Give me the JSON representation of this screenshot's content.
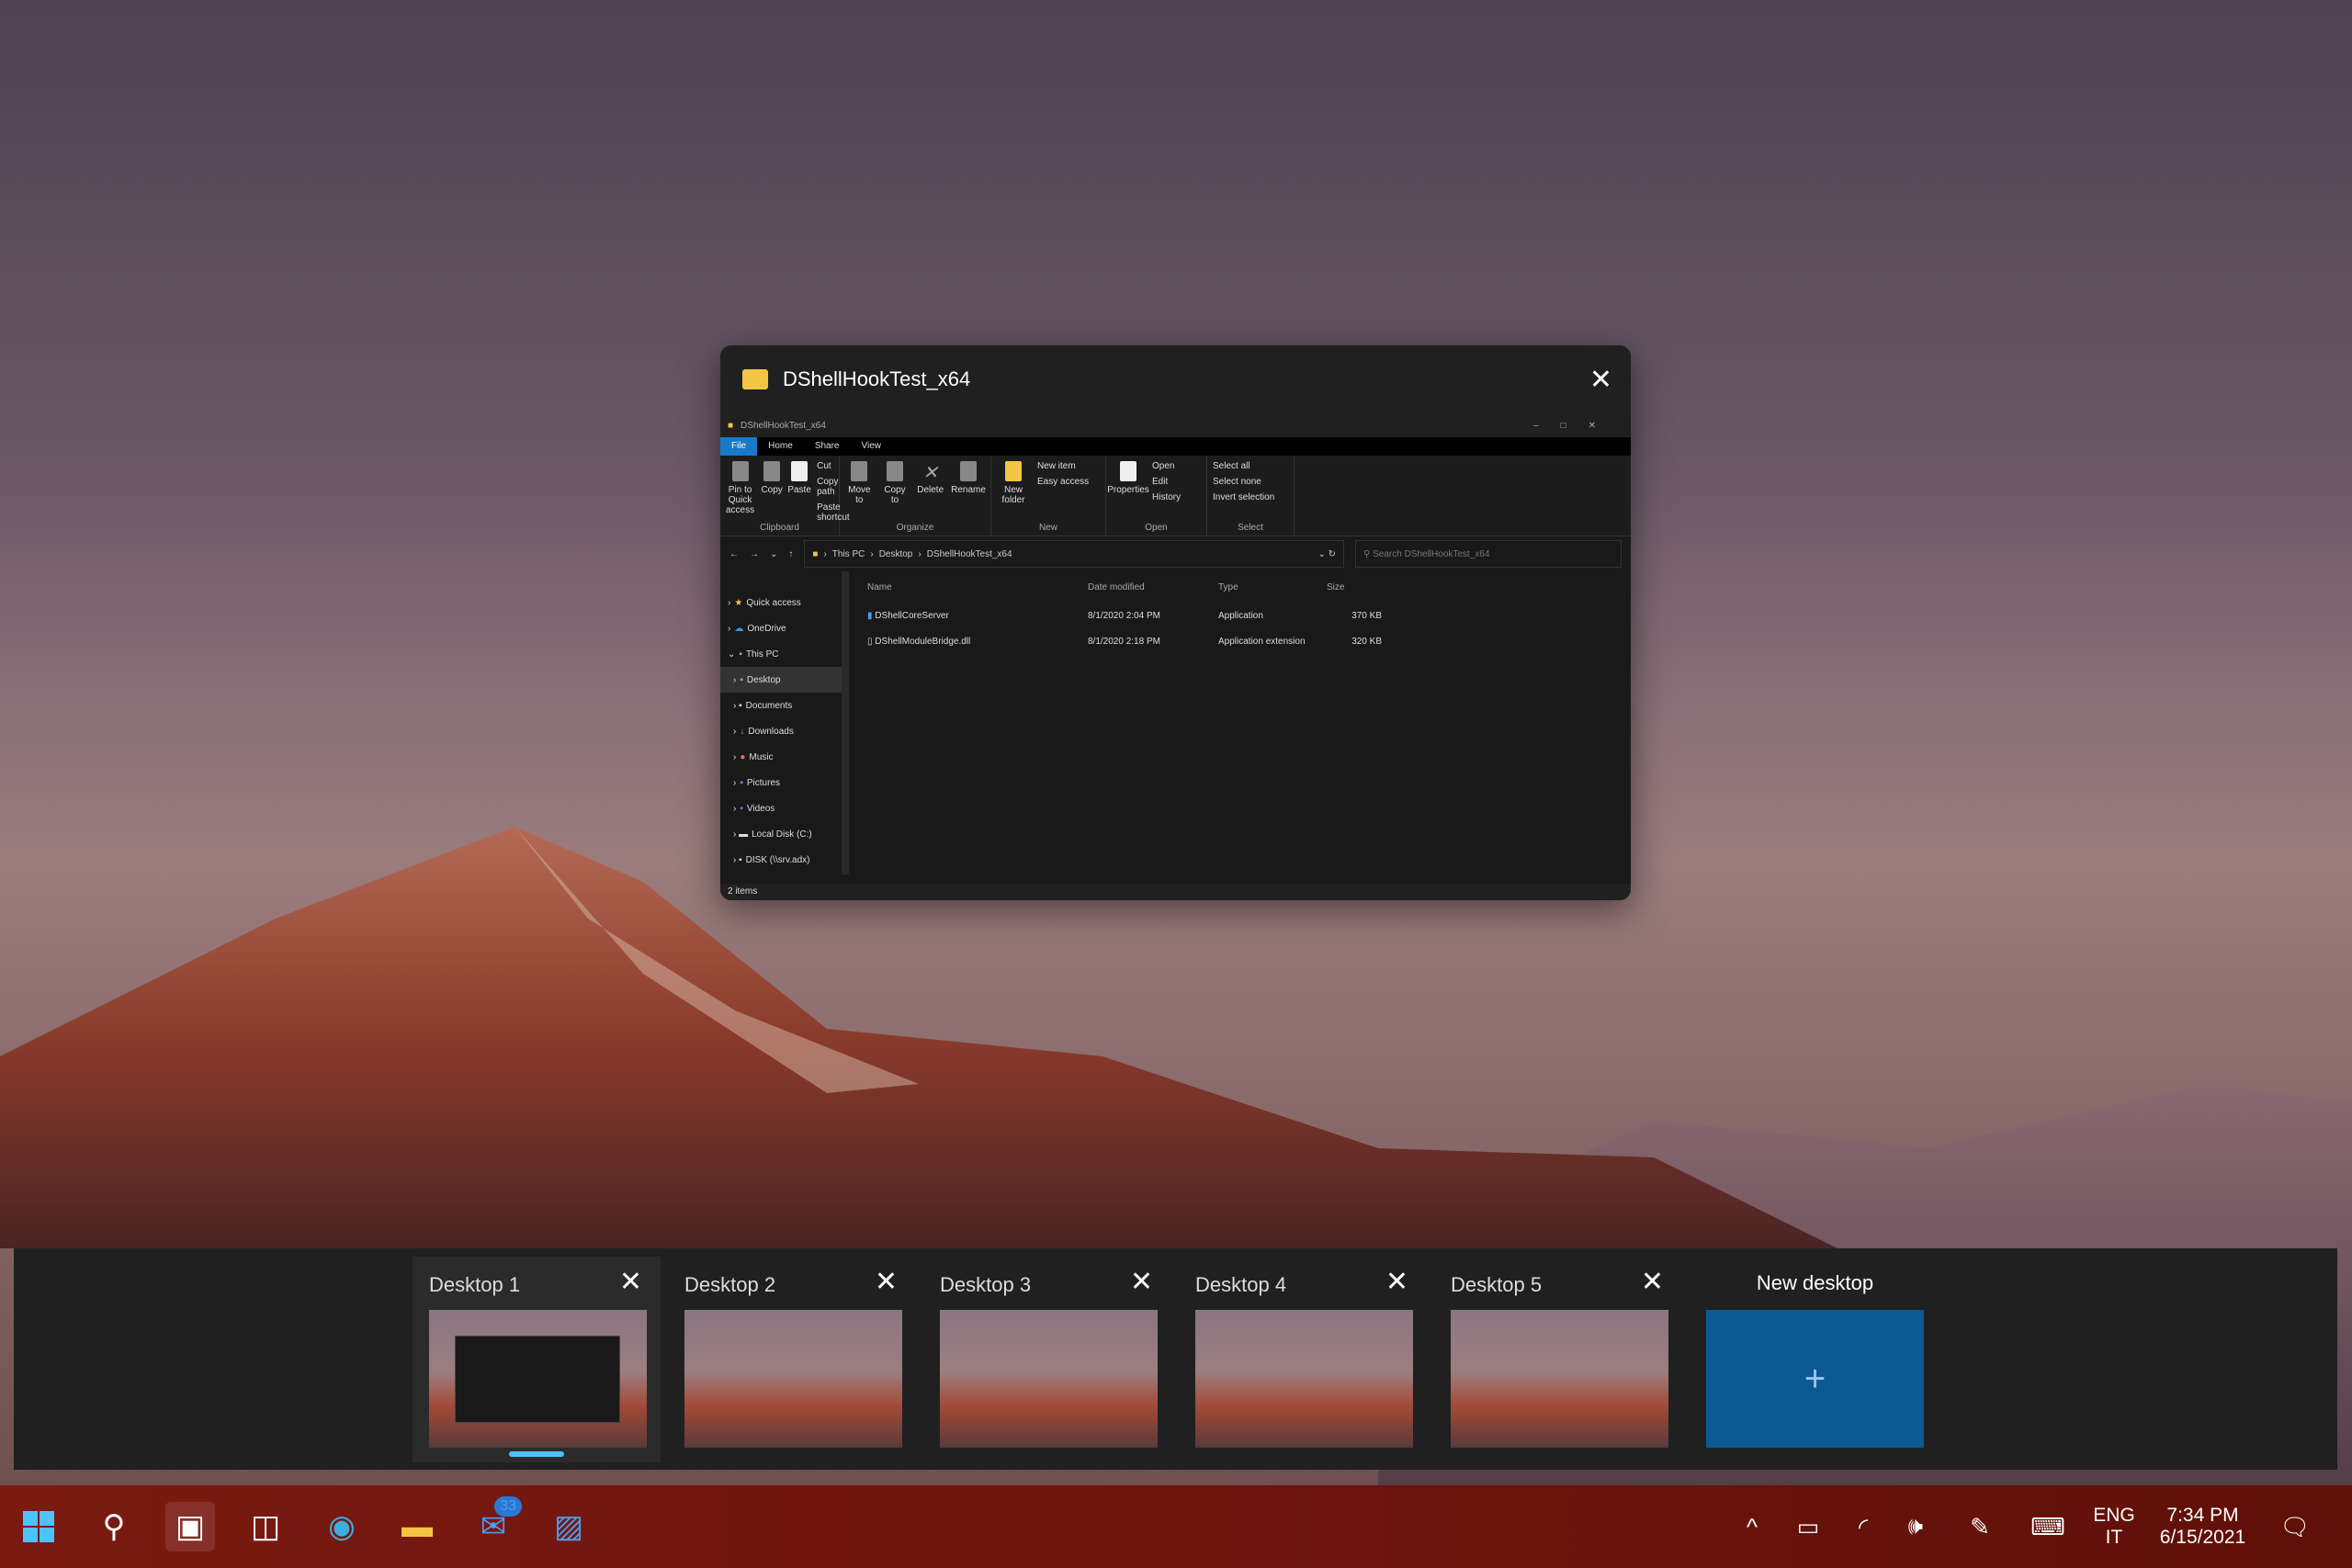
{
  "window_card": {
    "title": "DShellHookTest_x64",
    "close": "✕"
  },
  "explorer": {
    "title": "DShellHookTest_x64",
    "tabs": [
      "File",
      "Home",
      "Share",
      "View"
    ],
    "ribbon": {
      "clipboard": {
        "label": "Clipboard",
        "pin": "Pin to Quick access",
        "copy": "Copy",
        "paste": "Paste",
        "cut": "Cut",
        "copy_path": "Copy path",
        "paste_shortcut": "Paste shortcut"
      },
      "organize": {
        "label": "Organize",
        "move": "Move to",
        "copy": "Copy to",
        "delete": "Delete",
        "rename": "Rename"
      },
      "new": {
        "label": "New",
        "folder": "New folder",
        "item": "New item",
        "easy": "Easy access"
      },
      "open": {
        "label": "Open",
        "properties": "Properties",
        "open": "Open",
        "edit": "Edit",
        "history": "History"
      },
      "select": {
        "label": "Select",
        "all": "Select all",
        "none": "Select none",
        "invert": "Invert selection"
      }
    },
    "breadcrumb": [
      "This PC",
      "Desktop",
      "DShellHookTest_x64"
    ],
    "search_placeholder": "Search DShellHookTest_x64",
    "nav": [
      "Quick access",
      "OneDrive",
      "This PC",
      "Desktop",
      "Documents",
      "Downloads",
      "Music",
      "Pictures",
      "Videos",
      "Local Disk (C:)",
      "DISK (\\\\srv.adx)"
    ],
    "columns": [
      "Name",
      "Date modified",
      "Type",
      "Size"
    ],
    "files": [
      {
        "name": "DShellCoreServer",
        "date": "8/1/2020 2:04 PM",
        "type": "Application",
        "size": "370 KB"
      },
      {
        "name": "DShellModuleBridge.dll",
        "date": "8/1/2020 2:18 PM",
        "type": "Application extension",
        "size": "320 KB"
      }
    ],
    "status": "2 items"
  },
  "desktops": [
    {
      "label": "Desktop 1",
      "active": true
    },
    {
      "label": "Desktop 2"
    },
    {
      "label": "Desktop 3"
    },
    {
      "label": "Desktop 4"
    },
    {
      "label": "Desktop 5"
    }
  ],
  "new_desktop": {
    "label": "New desktop",
    "icon": "+"
  },
  "taskbar": {
    "mail_badge": "33",
    "lang": "ENG",
    "layout": "IT",
    "time": "7:34 PM",
    "date": "6/15/2021"
  },
  "colors": {
    "accent": "#4cc2ff",
    "new_desktop": "#0c5a94"
  }
}
